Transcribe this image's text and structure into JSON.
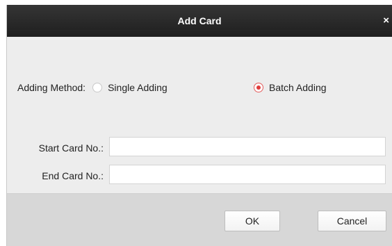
{
  "dialog": {
    "title": "Add Card",
    "close_glyph": "×"
  },
  "adding_method": {
    "label": "Adding Method:",
    "options": [
      {
        "label": "Single Adding",
        "selected": false
      },
      {
        "label": "Batch Adding",
        "selected": true
      }
    ]
  },
  "fields": {
    "start_card": {
      "label": "Start Card No.:",
      "value": ""
    },
    "end_card": {
      "label": "End Card No.:",
      "value": ""
    }
  },
  "buttons": {
    "ok": "OK",
    "cancel": "Cancel"
  },
  "colors": {
    "titlebar": "#2a2a2a",
    "radio_selected": "#e03b3b",
    "body_bg": "#ededed",
    "footer_bg": "#d7d7d7"
  },
  "icons": {
    "close": "close-icon"
  }
}
